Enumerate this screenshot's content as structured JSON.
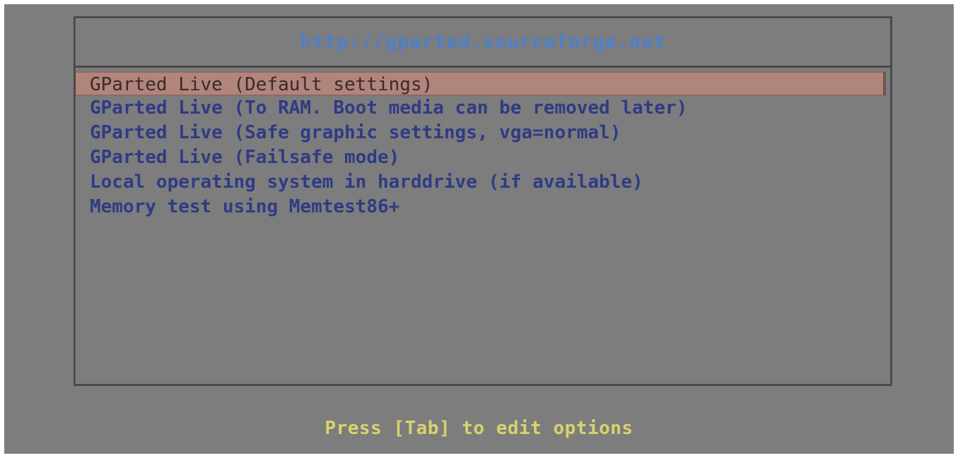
{
  "boot_menu": {
    "title": "http://gparted.sourceforge.net",
    "entries": [
      {
        "label": "GParted Live (Default settings)",
        "selected": true
      },
      {
        "label": "GParted Live (To RAM. Boot media can be removed later)",
        "selected": false
      },
      {
        "label": "GParted Live (Safe graphic settings, vga=normal)",
        "selected": false
      },
      {
        "label": "GParted Live (Failsafe mode)",
        "selected": false
      },
      {
        "label": "Local operating system in harddrive (if available)",
        "selected": false
      },
      {
        "label": "Memory test using Memtest86+",
        "selected": false
      }
    ]
  },
  "footer": {
    "hint": "Press [Tab] to edit options"
  },
  "colors": {
    "background": "#7d7d7d",
    "title": "#4f7fc9",
    "entry_text": "#2f3b84",
    "selected_background": "#b1847c",
    "hint_text": "#d9d36a"
  }
}
